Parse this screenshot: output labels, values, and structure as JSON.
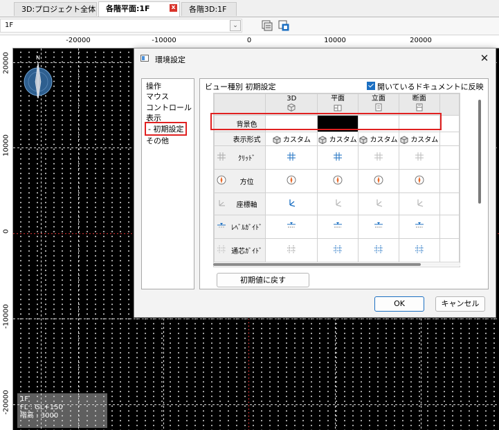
{
  "tabs": [
    {
      "label": "3D:プロジェクト全体",
      "active": false
    },
    {
      "label": "各階平面:1F",
      "active": true
    },
    {
      "label": "各階3D:1F",
      "active": false
    }
  ],
  "tab_close_glyph": "x",
  "toolbar": {
    "floor": "1F"
  },
  "ruler_top": [
    "-20000",
    "-10000",
    "0",
    "10000",
    "20000"
  ],
  "ruler_left": [
    "20000",
    "10000",
    "0",
    "-10000",
    "-20000"
  ],
  "compass_label": "N",
  "floor_info": {
    "line1": "1F",
    "line2": "FL : GL+150",
    "line3": "階高 : 3000"
  },
  "dialog": {
    "title": "環境設定",
    "categories": [
      "操作",
      "マウス",
      "コントロール",
      "表示",
      "- 初期設定",
      "その他"
    ],
    "selected_category": "- 初期設定",
    "panel_title": "ビュー種別 初期設定",
    "sync_checkbox": {
      "label": "開いているドキュメントに反映",
      "checked": true
    },
    "columns": [
      "3D",
      "平面",
      "立面",
      "断面"
    ],
    "rows": {
      "bg_color": {
        "label": "背景色",
        "colors": [
          "#ffffff",
          "#000000",
          "#ffffff",
          "#ffffff"
        ]
      },
      "display_format": {
        "label": "表示形式",
        "value": "カスタム"
      },
      "grid": {
        "label": "ｸﾘｯﾄﾞ"
      },
      "direction": {
        "label": "方位"
      },
      "axes": {
        "label": "座標軸"
      },
      "level_guide": {
        "label": "ﾚﾍﾞﾙｶﾞｲﾄﾞ"
      },
      "center_guide": {
        "label": "通芯ｶﾞｲﾄﾞ"
      }
    },
    "reset_button": "初期値に戻す",
    "ok_button": "OK",
    "cancel_button": "キャンセル",
    "close_glyph": "✕"
  }
}
